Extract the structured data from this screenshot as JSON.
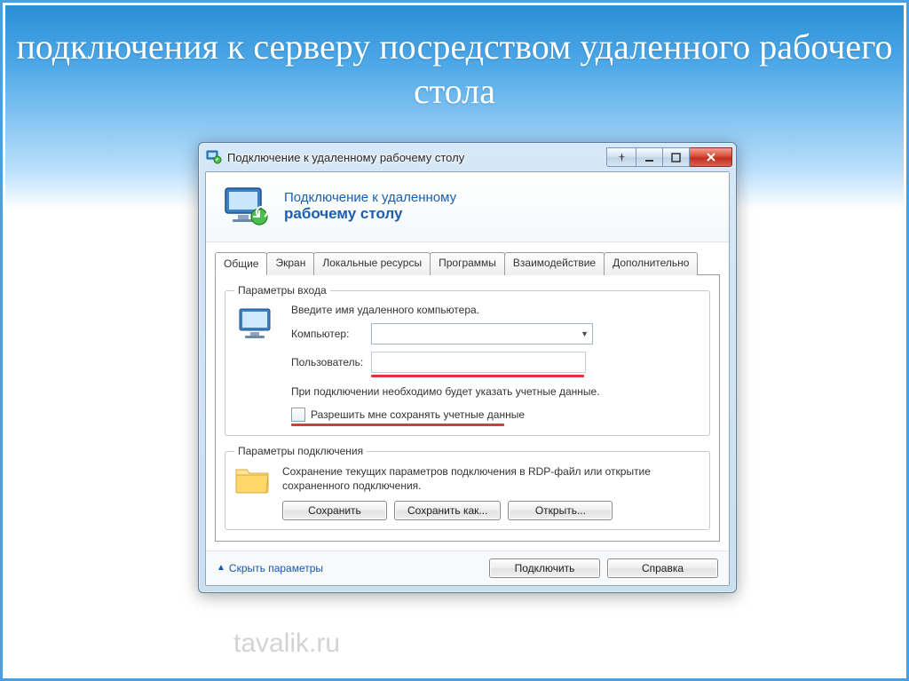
{
  "slide": {
    "title": "подключения к серверу посредством удаленного рабочего стола"
  },
  "window": {
    "title": "Подключение к удаленному рабочему столу",
    "header_line1": "Подключение к удаленному",
    "header_line2": "рабочему столу"
  },
  "tabs": {
    "general": "Общие",
    "display": "Экран",
    "local": "Локальные ресурсы",
    "programs": "Программы",
    "experience": "Взаимодействие",
    "advanced": "Дополнительно"
  },
  "login_group": {
    "legend": "Параметры входа",
    "instruction": "Введите имя удаленного компьютера.",
    "computer_label": "Компьютер:",
    "computer_value": "",
    "user_label": "Пользователь:",
    "user_value": "",
    "note": "При подключении необходимо будет указать учетные данные.",
    "checkbox_label": "Разрешить мне сохранять учетные данные"
  },
  "conn_group": {
    "legend": "Параметры подключения",
    "text": "Сохранение текущих параметров подключения в RDP-файл или открытие сохраненного подключения.",
    "save": "Сохранить",
    "save_as": "Сохранить как...",
    "open": "Открыть..."
  },
  "footer": {
    "hide_params": "Скрыть параметры",
    "connect": "Подключить",
    "help": "Справка"
  },
  "watermark": "tavalik.ru"
}
